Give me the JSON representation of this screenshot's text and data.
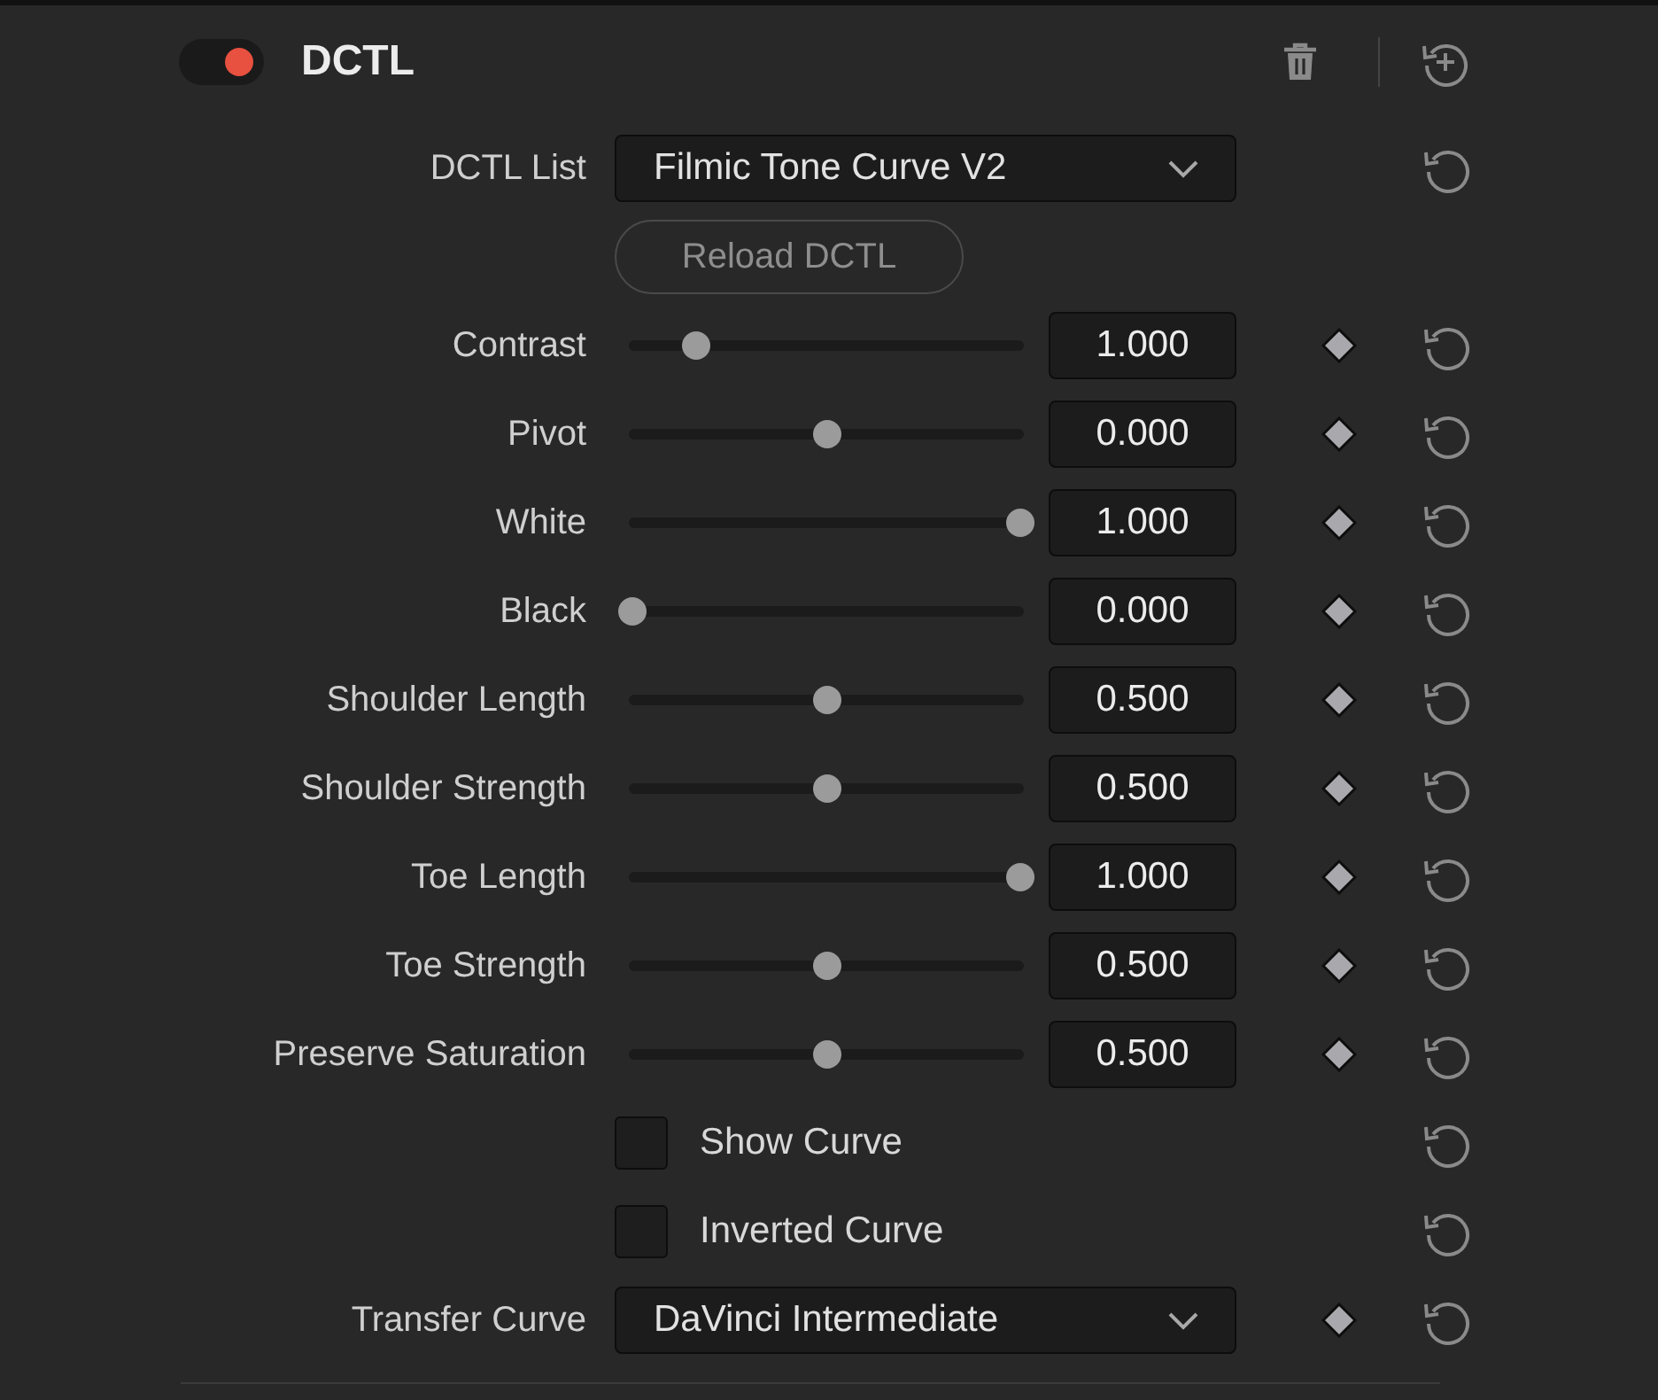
{
  "header": {
    "title": "DCTL",
    "enabled": true
  },
  "rows": [
    {
      "kind": "dropdown",
      "label": "DCTL List",
      "value": "Filmic Tone Curve V2",
      "keyframe": false,
      "reset": true
    },
    {
      "kind": "button",
      "text": "Reload DCTL",
      "disabled": true,
      "keyframe": false,
      "reset": false
    },
    {
      "kind": "slider",
      "label": "Contrast",
      "level": 0.164,
      "value": "1.000",
      "keyframe": true,
      "reset": true
    },
    {
      "kind": "slider",
      "label": "Pivot",
      "level": 0.5,
      "value": "0.000",
      "keyframe": true,
      "reset": true
    },
    {
      "kind": "slider",
      "label": "White",
      "level": 1,
      "value": "1.000",
      "keyframe": true,
      "reset": true
    },
    {
      "kind": "slider",
      "label": "Black",
      "level": 0,
      "value": "0.000",
      "keyframe": true,
      "reset": true
    },
    {
      "kind": "slider",
      "label": "Shoulder Length",
      "level": 0.5,
      "value": "0.500",
      "keyframe": true,
      "reset": true
    },
    {
      "kind": "slider",
      "label": "Shoulder Strength",
      "level": 0.5,
      "value": "0.500",
      "keyframe": true,
      "reset": true
    },
    {
      "kind": "slider",
      "label": "Toe Length",
      "level": 1,
      "value": "1.000",
      "keyframe": true,
      "reset": true
    },
    {
      "kind": "slider",
      "label": "Toe Strength",
      "level": 0.5,
      "value": "0.500",
      "keyframe": true,
      "reset": true
    },
    {
      "kind": "slider",
      "label": "Preserve Saturation",
      "level": 0.5,
      "value": "0.500",
      "keyframe": true,
      "reset": true
    },
    {
      "kind": "checkbox",
      "text": "Show Curve",
      "checked": false,
      "keyframe": false,
      "reset": true
    },
    {
      "kind": "checkbox",
      "text": "Inverted Curve",
      "checked": false,
      "keyframe": false,
      "reset": true
    },
    {
      "kind": "dropdown",
      "label": "Transfer Curve",
      "value": "DaVinci Intermediate",
      "keyframe": true,
      "reset": true
    }
  ]
}
